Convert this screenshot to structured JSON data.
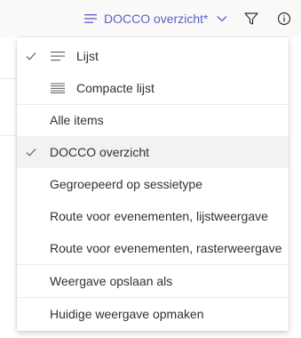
{
  "toolbar": {
    "view_label": "DOCCO overzicht*",
    "icons": {
      "view": "list-lines-icon",
      "dropdown": "chevron-down-icon",
      "filter": "filter-icon",
      "info": "info-icon"
    }
  },
  "menu": {
    "items": [
      {
        "label": "Lijst",
        "checked": true,
        "icon": "list-icon"
      },
      {
        "label": "Compacte lijst",
        "checked": false,
        "icon": "compact-list-icon"
      },
      {
        "label": "Alle items",
        "checked": false
      },
      {
        "label": "DOCCO overzicht",
        "checked": true,
        "selected": true
      },
      {
        "label": "Gegroepeerd op sessietype",
        "checked": false
      },
      {
        "label": "Route voor evenementen, lijstweergave",
        "checked": false
      },
      {
        "label": "Route voor evenementen, rasterweergave",
        "checked": false
      },
      {
        "label": "Weergave opslaan als",
        "checked": false
      },
      {
        "label": "Huidige weergave opmaken",
        "checked": false
      }
    ]
  },
  "colors": {
    "accent": "#5b5fc7",
    "text": "#323130",
    "selected_bg": "#f3f2f1",
    "divider": "#edebe9"
  }
}
